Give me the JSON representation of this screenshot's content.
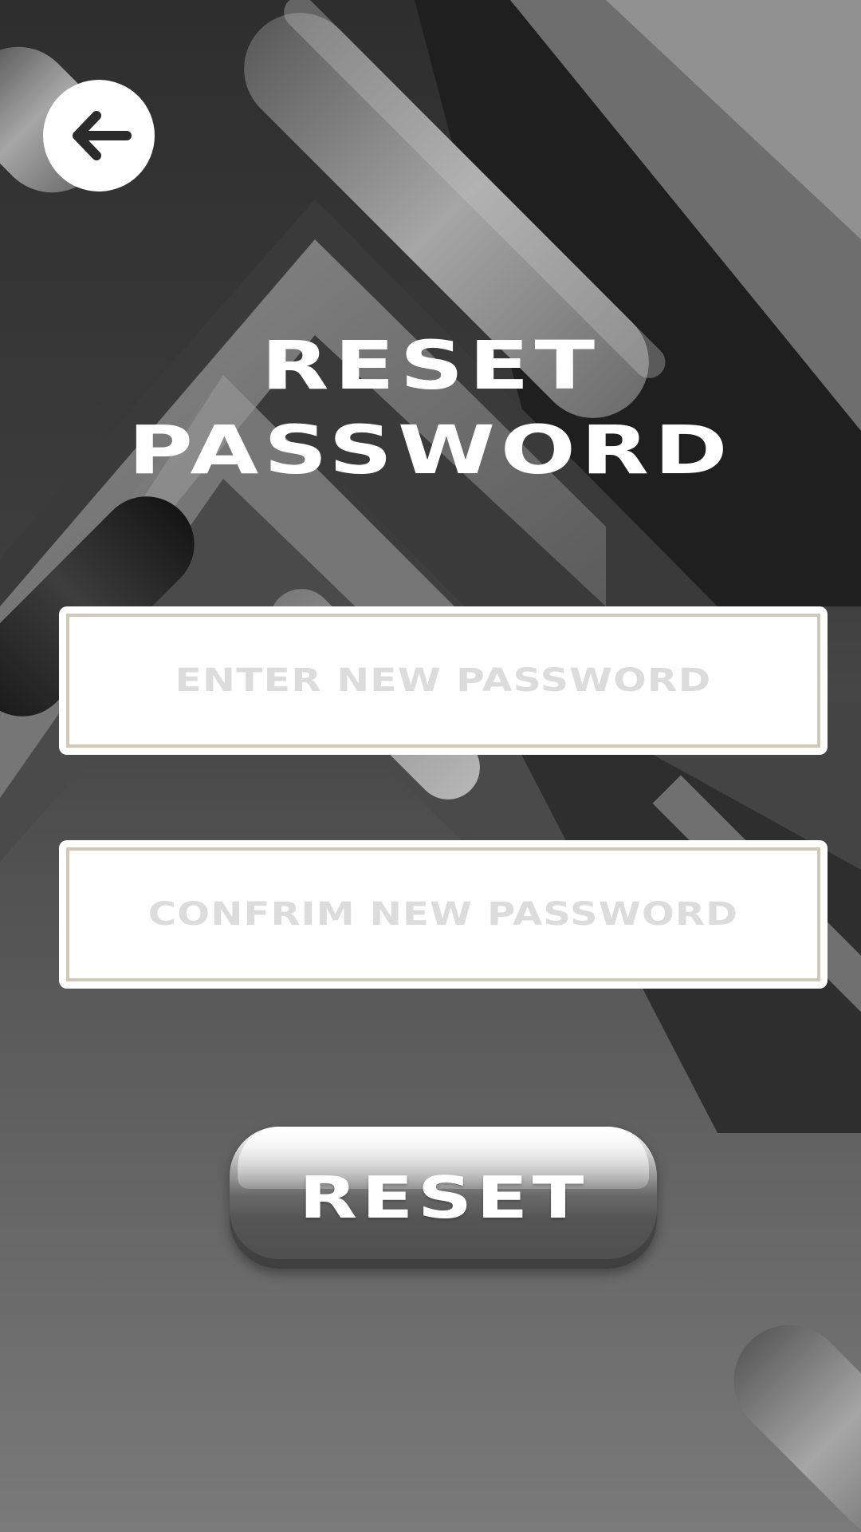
{
  "header": {
    "back_icon": "arrow-left-icon"
  },
  "title": {
    "line1": "RESET",
    "line2": "PASSWORD"
  },
  "form": {
    "new_password": {
      "value": "",
      "placeholder": "ENTER NEW PASSWORD"
    },
    "confirm_password": {
      "value": "",
      "placeholder": "CONFRIM NEW PASSWORD"
    }
  },
  "actions": {
    "reset_label": "RESET"
  },
  "colors": {
    "text": "#ffffff",
    "field_border": "#d3c7b5",
    "placeholder": "#dcdcdc"
  }
}
